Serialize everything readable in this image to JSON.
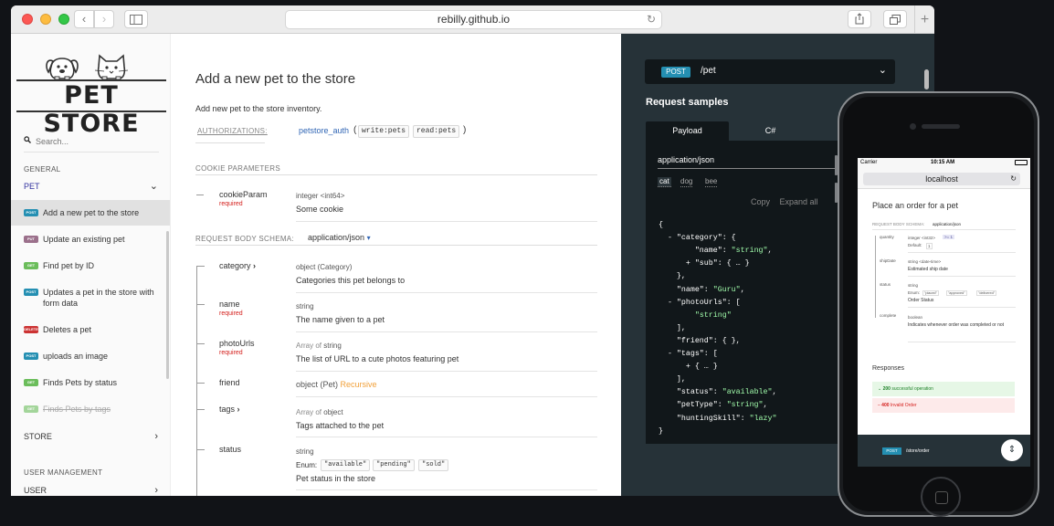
{
  "browser": {
    "url": "rebilly.github.io",
    "back_glyph": "‹",
    "forward_glyph": "›",
    "new_tab_glyph": "+"
  },
  "nav": {
    "logo_text": "PET STORE",
    "search_placeholder": "Search...",
    "general_label": "GENERAL",
    "pet_group": "PET",
    "items": [
      {
        "method": "POST",
        "label": "Add a new pet to the store"
      },
      {
        "method": "PUT",
        "label": "Update an existing pet"
      },
      {
        "method": "GET",
        "label": "Find pet by ID"
      },
      {
        "method": "POST",
        "label": "Updates a pet in the store with form data"
      },
      {
        "method": "DELETE",
        "label": "Deletes a pet"
      },
      {
        "method": "POST",
        "label": "uploads an image"
      },
      {
        "method": "GET",
        "label": "Finds Pets by status"
      },
      {
        "method": "GET",
        "label": "Finds Pets by tags"
      }
    ],
    "store_group": "STORE",
    "user_mgmt_label": "USER MANAGEMENT",
    "user_group": "USER"
  },
  "operation": {
    "title": "Add a new pet to the store",
    "description": "Add new pet to the store inventory.",
    "auth_label": "AUTHORIZATIONS:",
    "auth_name": "petstore_auth",
    "open_paren": "(",
    "close_paren": ")",
    "scopes": [
      "write:pets",
      "read:pets"
    ],
    "cookie_title": "COOKIE PARAMETERS",
    "cookie_param": {
      "name": "cookieParam",
      "required": "required",
      "type": "integer <int64>",
      "desc": "Some cookie"
    },
    "body_label": "REQUEST BODY SCHEMA:",
    "body_type": "application/json",
    "body_caret": "▾",
    "required_label": "required",
    "props": [
      {
        "name": "category",
        "chevron": "›",
        "type": "object (Category)",
        "desc": "Categories this pet belongs to"
      },
      {
        "name": "name",
        "type": "string",
        "desc": "The name given to a pet"
      },
      {
        "name": "photoUrls",
        "type_prefix": "Array of",
        "type": "string",
        "desc": "The list of URL to a cute photos featuring pet"
      },
      {
        "name": "friend",
        "type": "object (Pet)",
        "extra": "Recursive"
      },
      {
        "name": "tags",
        "chevron": "›",
        "type_prefix": "Array of",
        "type": "object",
        "desc": "Tags attached to the pet"
      },
      {
        "name": "status",
        "type": "string",
        "enum_label": "Enum:",
        "enum": [
          "\"available\"",
          "\"pending\"",
          "\"sold\""
        ],
        "desc": "Pet status in the store"
      }
    ]
  },
  "samples": {
    "method": "POST",
    "path": "/pet",
    "title": "Request samples",
    "tabs": [
      "Payload",
      "C#"
    ],
    "content_type": "application/json",
    "examples": [
      "cat",
      "dog",
      "bee"
    ],
    "actions": [
      "Copy",
      "Expand all"
    ],
    "code": [
      "{",
      "  - \"category\": {",
      "        \"name\": \"string\",",
      "      + \"sub\": { … }",
      "    },",
      "    \"name\": \"Guru\",",
      "  - \"photoUrls\": [",
      "        \"string\"",
      "    ],",
      "    \"friend\": { },",
      "  - \"tags\": [",
      "      + { … }",
      "    ],",
      "    \"status\": \"available\",",
      "    \"petType\": \"string\",",
      "    \"huntingSkill\": \"lazy\"",
      "}"
    ]
  },
  "phone": {
    "carrier": "Carrier",
    "time": "10:15 AM",
    "url": "localhost",
    "title": "Place an order for a pet",
    "body_label": "REQUEST BODY SCHEMA:",
    "body_type": "application/json",
    "fields": [
      {
        "name": "quantity",
        "type": "integer <int32>",
        "tag": ">= 1",
        "default_label": "Default:",
        "default": "1"
      },
      {
        "name": "shipDate",
        "type": "string <date-time>",
        "desc": "Estimated ship date"
      },
      {
        "name": "status",
        "type": "string",
        "enum_label": "Enum:",
        "enum": [
          "\"placed\"",
          "\"approved\"",
          "\"delivered\""
        ],
        "desc": "Order Status"
      },
      {
        "name": "complete",
        "type": "boolean",
        "desc": "Indicates whenever order was completed or not"
      }
    ],
    "responses_title": "Responses",
    "responses": [
      {
        "code": "200",
        "label": "successful operation"
      },
      {
        "code": "400",
        "label": "Invalid Order"
      }
    ],
    "footer_method": "POST",
    "footer_path": "/store/order"
  },
  "colors": {
    "post": "#248fb2",
    "put": "#9b708b",
    "get": "#6bbd5b",
    "delete": "#cc3333",
    "dark_panel": "#263238",
    "required": "#d41f1c",
    "link": "#3166b5"
  }
}
